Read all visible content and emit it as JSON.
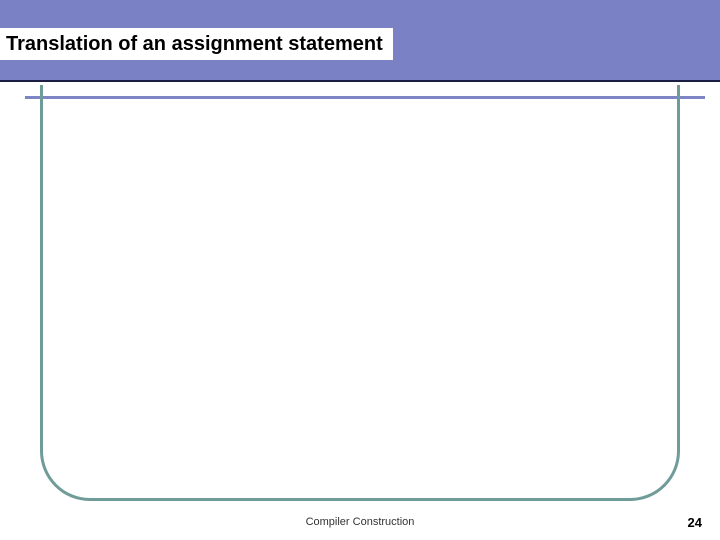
{
  "slide": {
    "title": "Translation of an assignment statement",
    "footer": "Compiler Construction",
    "page_number": "24"
  },
  "colors": {
    "banner": "#7a82c5",
    "frame_border": "#6f9b98",
    "underline": "#1a1e45"
  }
}
